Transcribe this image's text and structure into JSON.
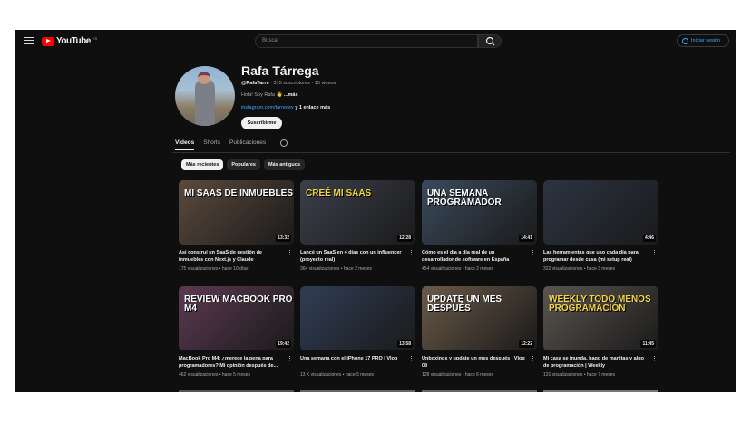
{
  "header": {
    "logo_text": "YouTube",
    "logo_region": "ES",
    "search_placeholder": "Buscar",
    "signin_label": "Iniciar sesión"
  },
  "channel": {
    "name": "Rafa Tárrega",
    "handle": "@RafaTarre",
    "subscribers": "315 suscriptores",
    "videos": "15 videos",
    "description": "Hola! Soy Rafa 👋",
    "more": "...más",
    "link": "instagram.com/tarredev",
    "more_links": "y 1 enlace más",
    "subscribe_label": "Suscribirme"
  },
  "tabs": [
    {
      "label": "Videos",
      "active": true
    },
    {
      "label": "Shorts"
    },
    {
      "label": "Publicaciones"
    }
  ],
  "chips": [
    {
      "label": "Más recientes",
      "active": true
    },
    {
      "label": "Populares"
    },
    {
      "label": "Más antiguos"
    }
  ],
  "videos": [
    {
      "title": "Así construí un SaaS de gestión de inmuebles con Next.js y Claude",
      "views": "175 visualizaciones",
      "age": "hace 10 días",
      "duration": "13:32",
      "thumb_text": "MI SAAS DE INMUEBLES",
      "bg": "#5b4a3c"
    },
    {
      "title": "Lancé un SaaS en 4 días con un influencer (proyecto real)",
      "views": "364 visualizaciones",
      "age": "hace 2 meses",
      "duration": "12:28",
      "thumb_text": "CREÉ MI SAAS",
      "bg": "#3b3f4a"
    },
    {
      "title": "Cómo es el día a día real de un desarrollador de software en España",
      "views": "454 visualizaciones",
      "age": "hace 2 meses",
      "duration": "14:41",
      "thumb_text": "UNA SEMANA PROGRAMADOR",
      "bg": "#3a4a5c"
    },
    {
      "title": "Las herramientas que uso cada día para programar desde casa (mi setup real)",
      "views": "322 visualizaciones",
      "age": "hace 3 meses",
      "duration": "4:46",
      "thumb_text": "",
      "bg": "#2c3442"
    },
    {
      "title": "MacBook Pro M4: ¿merece la pena para programadores? Mi opinión después de...",
      "views": "462 visualizaciones",
      "age": "hace 5 meses",
      "duration": "19:42",
      "thumb_text": "REVIEW MACBOOK PRO M4",
      "bg": "#5c3a52"
    },
    {
      "title": "Una semana con el iPhone 17 PRO | Vlog",
      "views": "13 K visualizaciones",
      "age": "hace 5 meses",
      "duration": "13:58",
      "thumb_text": "",
      "bg": "#2f3d55"
    },
    {
      "title": "Unboxings y update un mes después | Vlog 08",
      "views": "128 visualizaciones",
      "age": "hace 6 meses",
      "duration": "12:22",
      "thumb_text": "UPDATE UN MES DESPUÉS",
      "bg": "#6b5a48"
    },
    {
      "title": "Mi casa se inunda, hago de manitas y algo de programación | Weekly",
      "views": "131 visualizaciones",
      "age": "hace 7 meses",
      "duration": "11:45",
      "thumb_text": "WEEKLY TODO MENOS PROGRAMACIÓN",
      "bg": "#5a5550"
    }
  ]
}
